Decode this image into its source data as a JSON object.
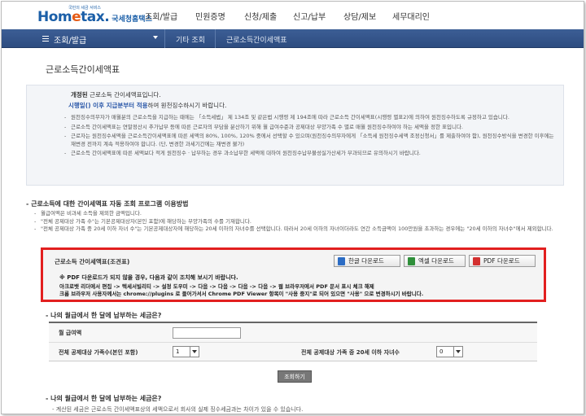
{
  "brand": {
    "logo": "Hometax",
    "tagline": "국민의 세금 서비스",
    "org": "국세청홈택스"
  },
  "nav": [
    "조회/발급",
    "민원증명",
    "신청/제출",
    "신고/납부",
    "상담/제보",
    "세무대리인"
  ],
  "topbar": {
    "section": "조회/발급",
    "crumb1": "기타 조회",
    "crumb2": "근로소득간이세액표"
  },
  "page_title": "근로소득간이세액표",
  "info": {
    "line1_bold": "개정된",
    "line1_rest": " 근로소득 간이세액표입니다.",
    "line2_bold": "시행일() 이후 지급분부터 적용",
    "line2_rest": "하여 원천징수하시기 바랍니다.",
    "bullets": [
      "원천징수의무자가 매월분의 근로소득을 지급하는 때에는 「소득세법」 제 134조 및 같은법 시행령 제 194조에 따라 근로소득 간이세액표(시행령 별표2)에 의하여 원천징수하도록 규정하고 있습니다.",
      "근로소득 간이세액표는 연말정산시 추가납부 등에 따른 근로자의 부담을 분산하기 위해 월 급여수준과 공제대상 부양가족 수 별로 매월 원천징수하여야 하는 세액을 정한 표입니다.",
      "근로자는 원천징수세액을 근로소득간이세액표에 따른 세액의 80%, 100%, 120% 중에서 선택할 수 있으며(원천징수의무자에게 「소득세 원천징수세액 조정신청서」를 제출하여야 함), 원천징수방식을 변경한 이후에는 재변경 전까지 계속 적용하여야 합니다. (단, 변경한 과세기간에는 재변경 불가)",
      "근로소득 간이세액표에 따른 세액보다 적게 원천징수 · 납부하는 경우 과소납부한 세액에 대하여 원천징수납부불성실가산세가 부과되므로 유의하시기 바랍니다."
    ]
  },
  "section1_title": "근로소득에 대한 간이세액표 자동 조회 프로그램 이용방법",
  "notes": [
    "월급여액은 비과세 소득을 제외한 금액입니다.",
    "\"전체 공제대상 가족 수\"는 기본공제대상자(본인 포함)에 해당하는 부양가족의 수를 기재합니다.",
    "\"전체 공제대상 가족 중 20세 이하 자녀 수\"는 기본공제대상자에 해당하는 20세 이하의 자녀수를 선택합니다. 따라서 20세 이하의 자녀이더라도 연간 소득금액이 100만원을 초과하는 경우에는 \"20세 이하의 자녀수\"에서 제외합니다."
  ],
  "download": {
    "title": "근로소득 간이세액표(조견표)",
    "buttons": [
      "한글 다운로드",
      "엑셀 다운로드",
      "PDF 다운로드"
    ],
    "warning": "※ PDF 다운로드가 되지 않을 경우, 다음과 같이 조치해 보시기 바랍니다.",
    "acrobat": "아크로뱃 리더에서 편집 -> 텍세서빌리티 -> 설정 도우미 -> 다음 -> 다음 -> 다음 -> 다음 -> 웹 브라우저에서 PDF 문서 표시 체크 해제",
    "chrome": "크롬 브라우저 사용자께서는 chrome://plugins 로 들어가셔서 Chrome PDF Viewer 항목이 \"사용 중지\"로 되어 있으면 \"사용\" 으로 변경하시기 바랍니다."
  },
  "section2_title": "나의 월급에서 한 달에 납부하는 세금은?",
  "form": {
    "salary_label": "월 급여액",
    "salary_value": "",
    "family_label": "전체 공제대상 가족수(본인 포함)",
    "family_value": "1",
    "children_label": "전체 공제대상 가족 중 20세 이하 자녀수",
    "children_value": "0",
    "submit": "조회하기"
  },
  "section3_title": "나의 월급에서 한 달에 납부하는 세금은?",
  "footer_note": "계산된 세금은    근로소득 간이세액표상의 세액으로서 회사의 실제 징수세금과는 차이가 있을 수 있습니다."
}
